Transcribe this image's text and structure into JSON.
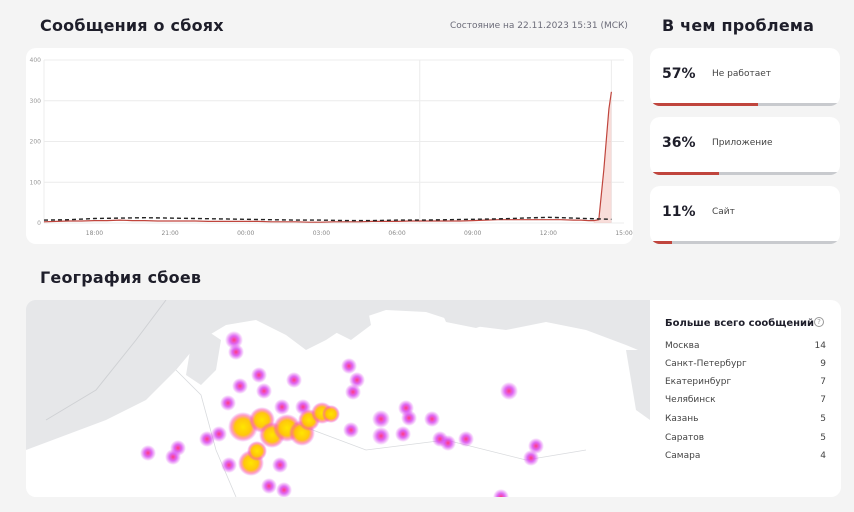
{
  "header": {
    "title": "Сообщения о сбоях",
    "status": "Состояние на 22.11.2023 15:31 (МСК)"
  },
  "chart_data": {
    "type": "line",
    "x_ticks": [
      "18:00",
      "21:00",
      "00:00",
      "03:00",
      "06:00",
      "09:00",
      "12:00",
      "15:00"
    ],
    "y_ticks": [
      0,
      100,
      200,
      300,
      400
    ],
    "ylim": [
      0,
      400
    ],
    "series": [
      {
        "style": "solid",
        "color": "#c0453d",
        "x": [
          0,
          0.5,
          1,
          1.5,
          2,
          2.5,
          3,
          3.5,
          4,
          4.5,
          5,
          5.5,
          6,
          6.5,
          7,
          7.5,
          8,
          8.5,
          9,
          9.5,
          10,
          10.5,
          11,
          11.5,
          12,
          12.5,
          13,
          13.5,
          14,
          14.5,
          15,
          15.5,
          16,
          16.5,
          17,
          17.5,
          18,
          18.5,
          19,
          19.5,
          20,
          20.5,
          21,
          21.3,
          21.6,
          21.8,
          22,
          22.2,
          22.4,
          22.5
        ],
        "values": [
          3,
          4,
          5,
          5,
          6,
          6,
          7,
          6,
          6,
          5,
          5,
          5,
          5,
          4,
          4,
          4,
          4,
          4,
          3,
          3,
          3,
          2,
          2,
          3,
          3,
          3,
          4,
          4,
          4,
          5,
          5,
          5,
          5,
          5,
          6,
          7,
          8,
          8,
          8,
          8,
          8,
          8,
          7,
          7,
          6,
          6,
          8,
          130,
          280,
          322
        ]
      },
      {
        "style": "dashed",
        "color": "#222222",
        "x": [
          0,
          1,
          2,
          3,
          4,
          5,
          6,
          7,
          8,
          9,
          10,
          11,
          12,
          13,
          14,
          15,
          16,
          17,
          18,
          19,
          20,
          21,
          22,
          22.5
        ],
        "values": [
          7,
          8,
          11,
          12,
          13,
          12,
          11,
          10,
          9,
          8,
          7,
          7,
          6,
          6,
          7,
          7,
          8,
          9,
          10,
          12,
          14,
          12,
          10,
          9
        ]
      }
    ]
  },
  "problems": {
    "title": "В чем проблема",
    "items": [
      {
        "pct": "57%",
        "label": "Не работает",
        "fill": 0.57
      },
      {
        "pct": "36%",
        "label": "Приложение",
        "fill": 0.36
      },
      {
        "pct": "11%",
        "label": "Сайт",
        "fill": 0.11
      }
    ]
  },
  "geography": {
    "title": "География сбоев",
    "top_title": "Больше всего сообщений",
    "info_icon": "?",
    "cities": [
      {
        "name": "Москва",
        "value": "14"
      },
      {
        "name": "Санкт-Петербург",
        "value": "9"
      },
      {
        "name": "Екатеринбург",
        "value": "7"
      },
      {
        "name": "Челябинск",
        "value": "7"
      },
      {
        "name": "Казань",
        "value": "5"
      },
      {
        "name": "Саратов",
        "value": "5"
      },
      {
        "name": "Самара",
        "value": "4"
      }
    ]
  },
  "colors": {
    "accent": "#c0453d",
    "heat_low": "#d94cf0",
    "heat_high": "#ffe600"
  }
}
